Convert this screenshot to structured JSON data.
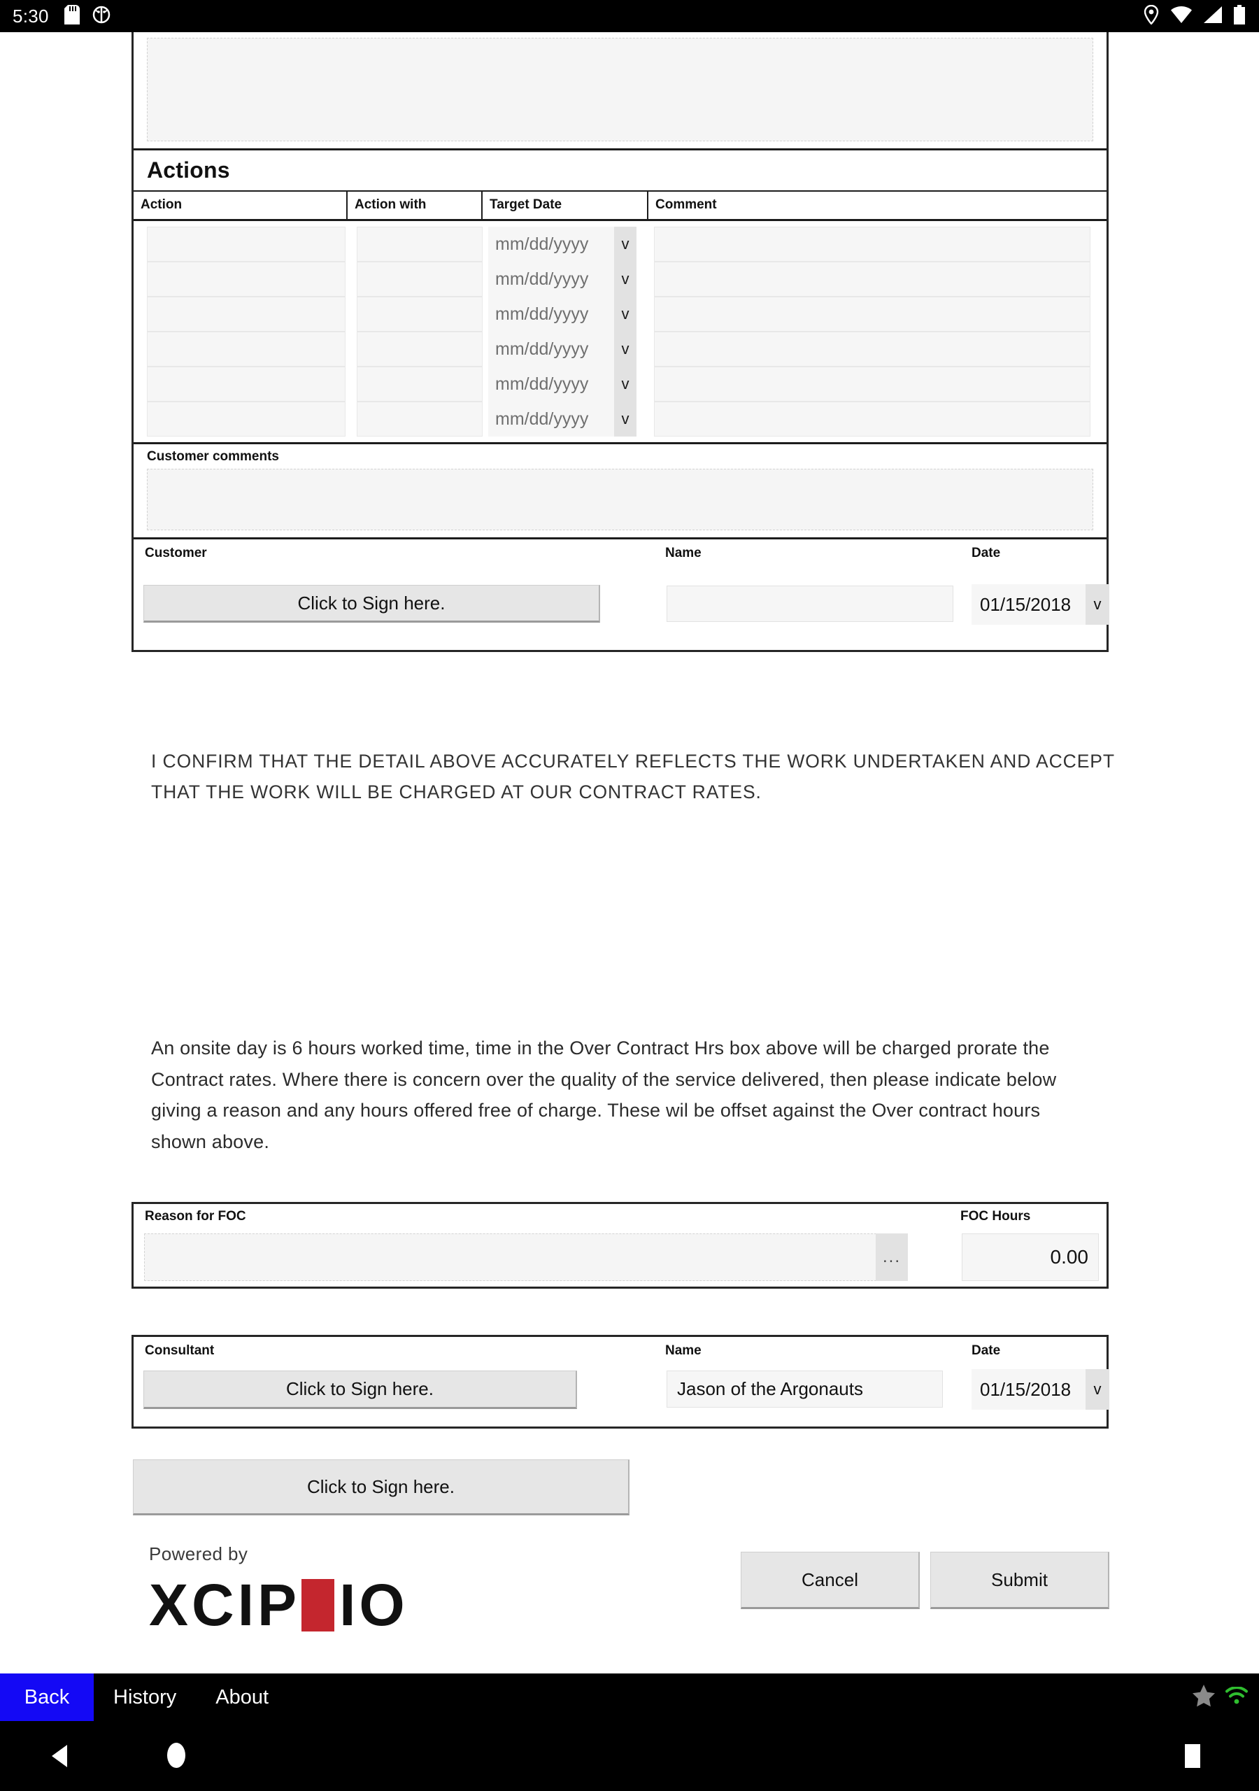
{
  "status_bar": {
    "time": "5:30",
    "left_icons": [
      "sd-card-icon",
      "android-debug-icon"
    ],
    "right_icons": [
      "location-pin-icon",
      "wifi-icon",
      "cellular-signal-icon",
      "battery-icon"
    ]
  },
  "form": {
    "top_textarea_value": "",
    "actions": {
      "title": "Actions",
      "columns": [
        "Action",
        "Action with",
        "Target Date",
        "Comment"
      ],
      "rows": [
        {
          "action": "",
          "action_with": "",
          "target_date": "",
          "target_date_placeholder": "mm/dd/yyyy",
          "comment": ""
        },
        {
          "action": "",
          "action_with": "",
          "target_date": "",
          "target_date_placeholder": "mm/dd/yyyy",
          "comment": ""
        },
        {
          "action": "",
          "action_with": "",
          "target_date": "",
          "target_date_placeholder": "mm/dd/yyyy",
          "comment": ""
        },
        {
          "action": "",
          "action_with": "",
          "target_date": "",
          "target_date_placeholder": "mm/dd/yyyy",
          "comment": ""
        },
        {
          "action": "",
          "action_with": "",
          "target_date": "",
          "target_date_placeholder": "mm/dd/yyyy",
          "comment": ""
        },
        {
          "action": "",
          "action_with": "",
          "target_date": "",
          "target_date_placeholder": "mm/dd/yyyy",
          "comment": ""
        }
      ]
    },
    "customer_comments": {
      "label": "Customer comments",
      "value": ""
    },
    "customer_signature": {
      "label": "Customer",
      "sign_button": "Click to Sign here.",
      "name_label": "Name",
      "name_value": "",
      "date_label": "Date",
      "date_value": "01/15/2018",
      "date_arrow": "v"
    }
  },
  "confirm_text": "I CONFIRM THAT THE DETAIL ABOVE ACCURATELY  REFLECTS  THE  WORK  UNDERTAKEN  AND ACCEPT THAT  THE  WORK  WILL  BE CHARGED  AT OUR  CONTRACT  RATES.",
  "onsite_text": "An onsite day is 6 hours worked time, time in the Over Contract  Hrs  box above will be charged prorate the Contract rates. Where there is concern over the quality of the service delivered, then please indicate below giving a reason and any hours offered free of charge. These wil be offset against the Over contract  hours shown above.",
  "foc": {
    "reason_label": "Reason for FOC",
    "reason_value": "",
    "ellipsis_button": "...",
    "hours_label": "FOC Hours",
    "hours_value": "0.00"
  },
  "consultant_signature": {
    "label": "Consultant",
    "sign_button": "Click to Sign here.",
    "name_label": "Name",
    "name_value": "Jason of the Argonauts",
    "date_label": "Date",
    "date_value": "01/15/2018",
    "date_arrow": "v"
  },
  "bottom_sign_button": "Click to Sign here.",
  "branding": {
    "powered_by": "Powered by",
    "logo_part1": "XCIP",
    "logo_part2": "IO",
    "logo_square_color": "#c4262e"
  },
  "form_actions": {
    "cancel": "Cancel",
    "submit": "Submit"
  },
  "app_nav": {
    "back": "Back",
    "history": "History",
    "about": "About",
    "right_icons": [
      "star-icon",
      "wifi-status-icon"
    ],
    "back_color": "#1409f5"
  },
  "soft_keys": [
    "back-triangle-icon",
    "home-circle-icon",
    "recents-square-icon"
  ]
}
